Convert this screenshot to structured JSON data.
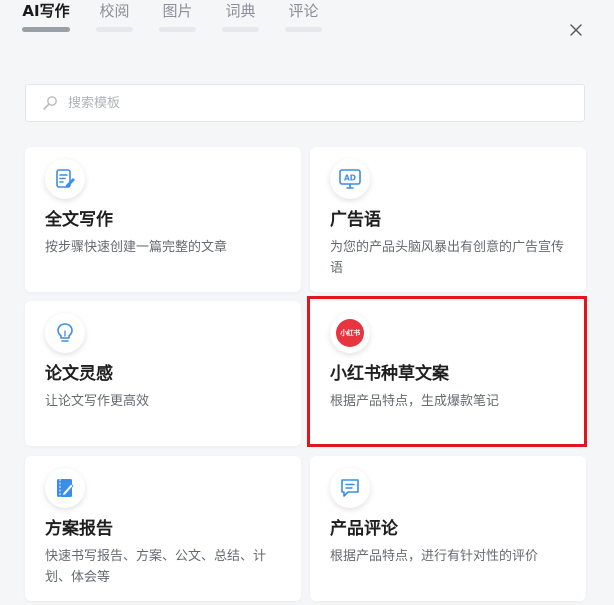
{
  "tabs": [
    {
      "label": "AI写作",
      "active": true
    },
    {
      "label": "校阅",
      "active": false
    },
    {
      "label": "图片",
      "active": false
    },
    {
      "label": "词典",
      "active": false
    },
    {
      "label": "评论",
      "active": false
    }
  ],
  "search": {
    "placeholder": "搜索模板",
    "value": ""
  },
  "cards": [
    {
      "title": "全文写作",
      "desc": "按步骤快速创建一篇完整的文章",
      "icon": "edit-document-icon"
    },
    {
      "title": "广告语",
      "desc": "为您的产品头脑风暴出有创意的广告宣传语",
      "icon": "ad-monitor-icon"
    },
    {
      "title": "论文灵感",
      "desc": "让论文写作更高效",
      "icon": "lightbulb-icon"
    },
    {
      "title": "小红书种草文案",
      "desc": "根据产品特点，生成爆款笔记",
      "icon": "xiaohongshu-logo-icon",
      "logo_text": "小红书"
    },
    {
      "title": "方案报告",
      "desc": "快速书写报告、方案、公文、总结、计划、体会等",
      "icon": "notebook-pen-icon"
    },
    {
      "title": "产品评论",
      "desc": "根据产品特点，进行有针对性的评价",
      "icon": "comment-icon"
    }
  ],
  "colors": {
    "accent_blue": "#3b8ee8",
    "highlight_red": "#e0161f",
    "xiaohongshu_red": "#e8343f",
    "background": "#f5f6f8"
  }
}
